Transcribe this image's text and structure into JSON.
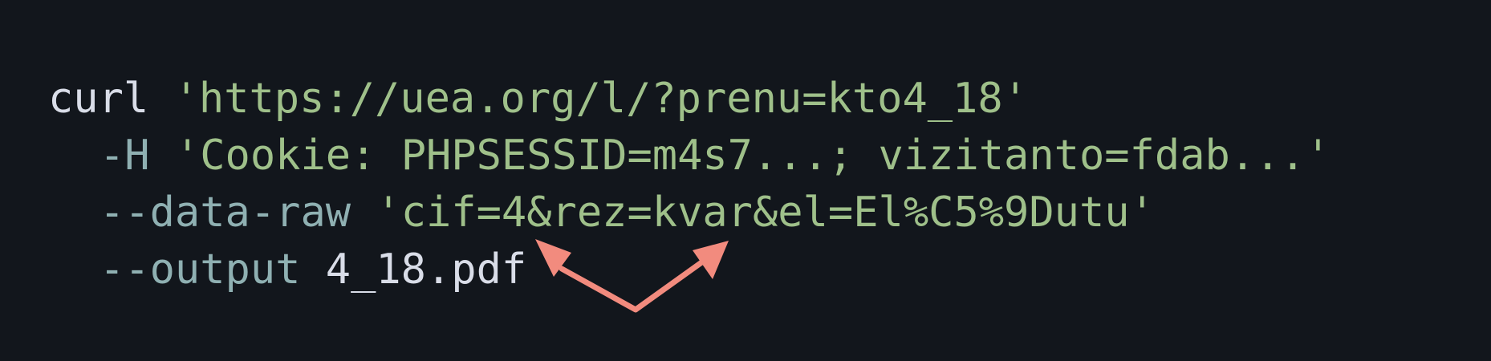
{
  "terminal": {
    "line1": {
      "command": "curl",
      "url": "'https://uea.org/l/?prenu=kto4_18'"
    },
    "line2": {
      "flag": "-H",
      "value": "'Cookie: PHPSESSID=m4s7...; vizitanto=fdab...'"
    },
    "line3": {
      "flag": "--data-raw",
      "value": "'cif=4&rez=kvar&el=El%C5%9Dutu'"
    },
    "line4": {
      "flag": "--output",
      "value": "4_18.pdf"
    }
  },
  "annotation": {
    "arrow_color": "#f28b7e",
    "icon": "double-arrow-annotation-icon"
  }
}
